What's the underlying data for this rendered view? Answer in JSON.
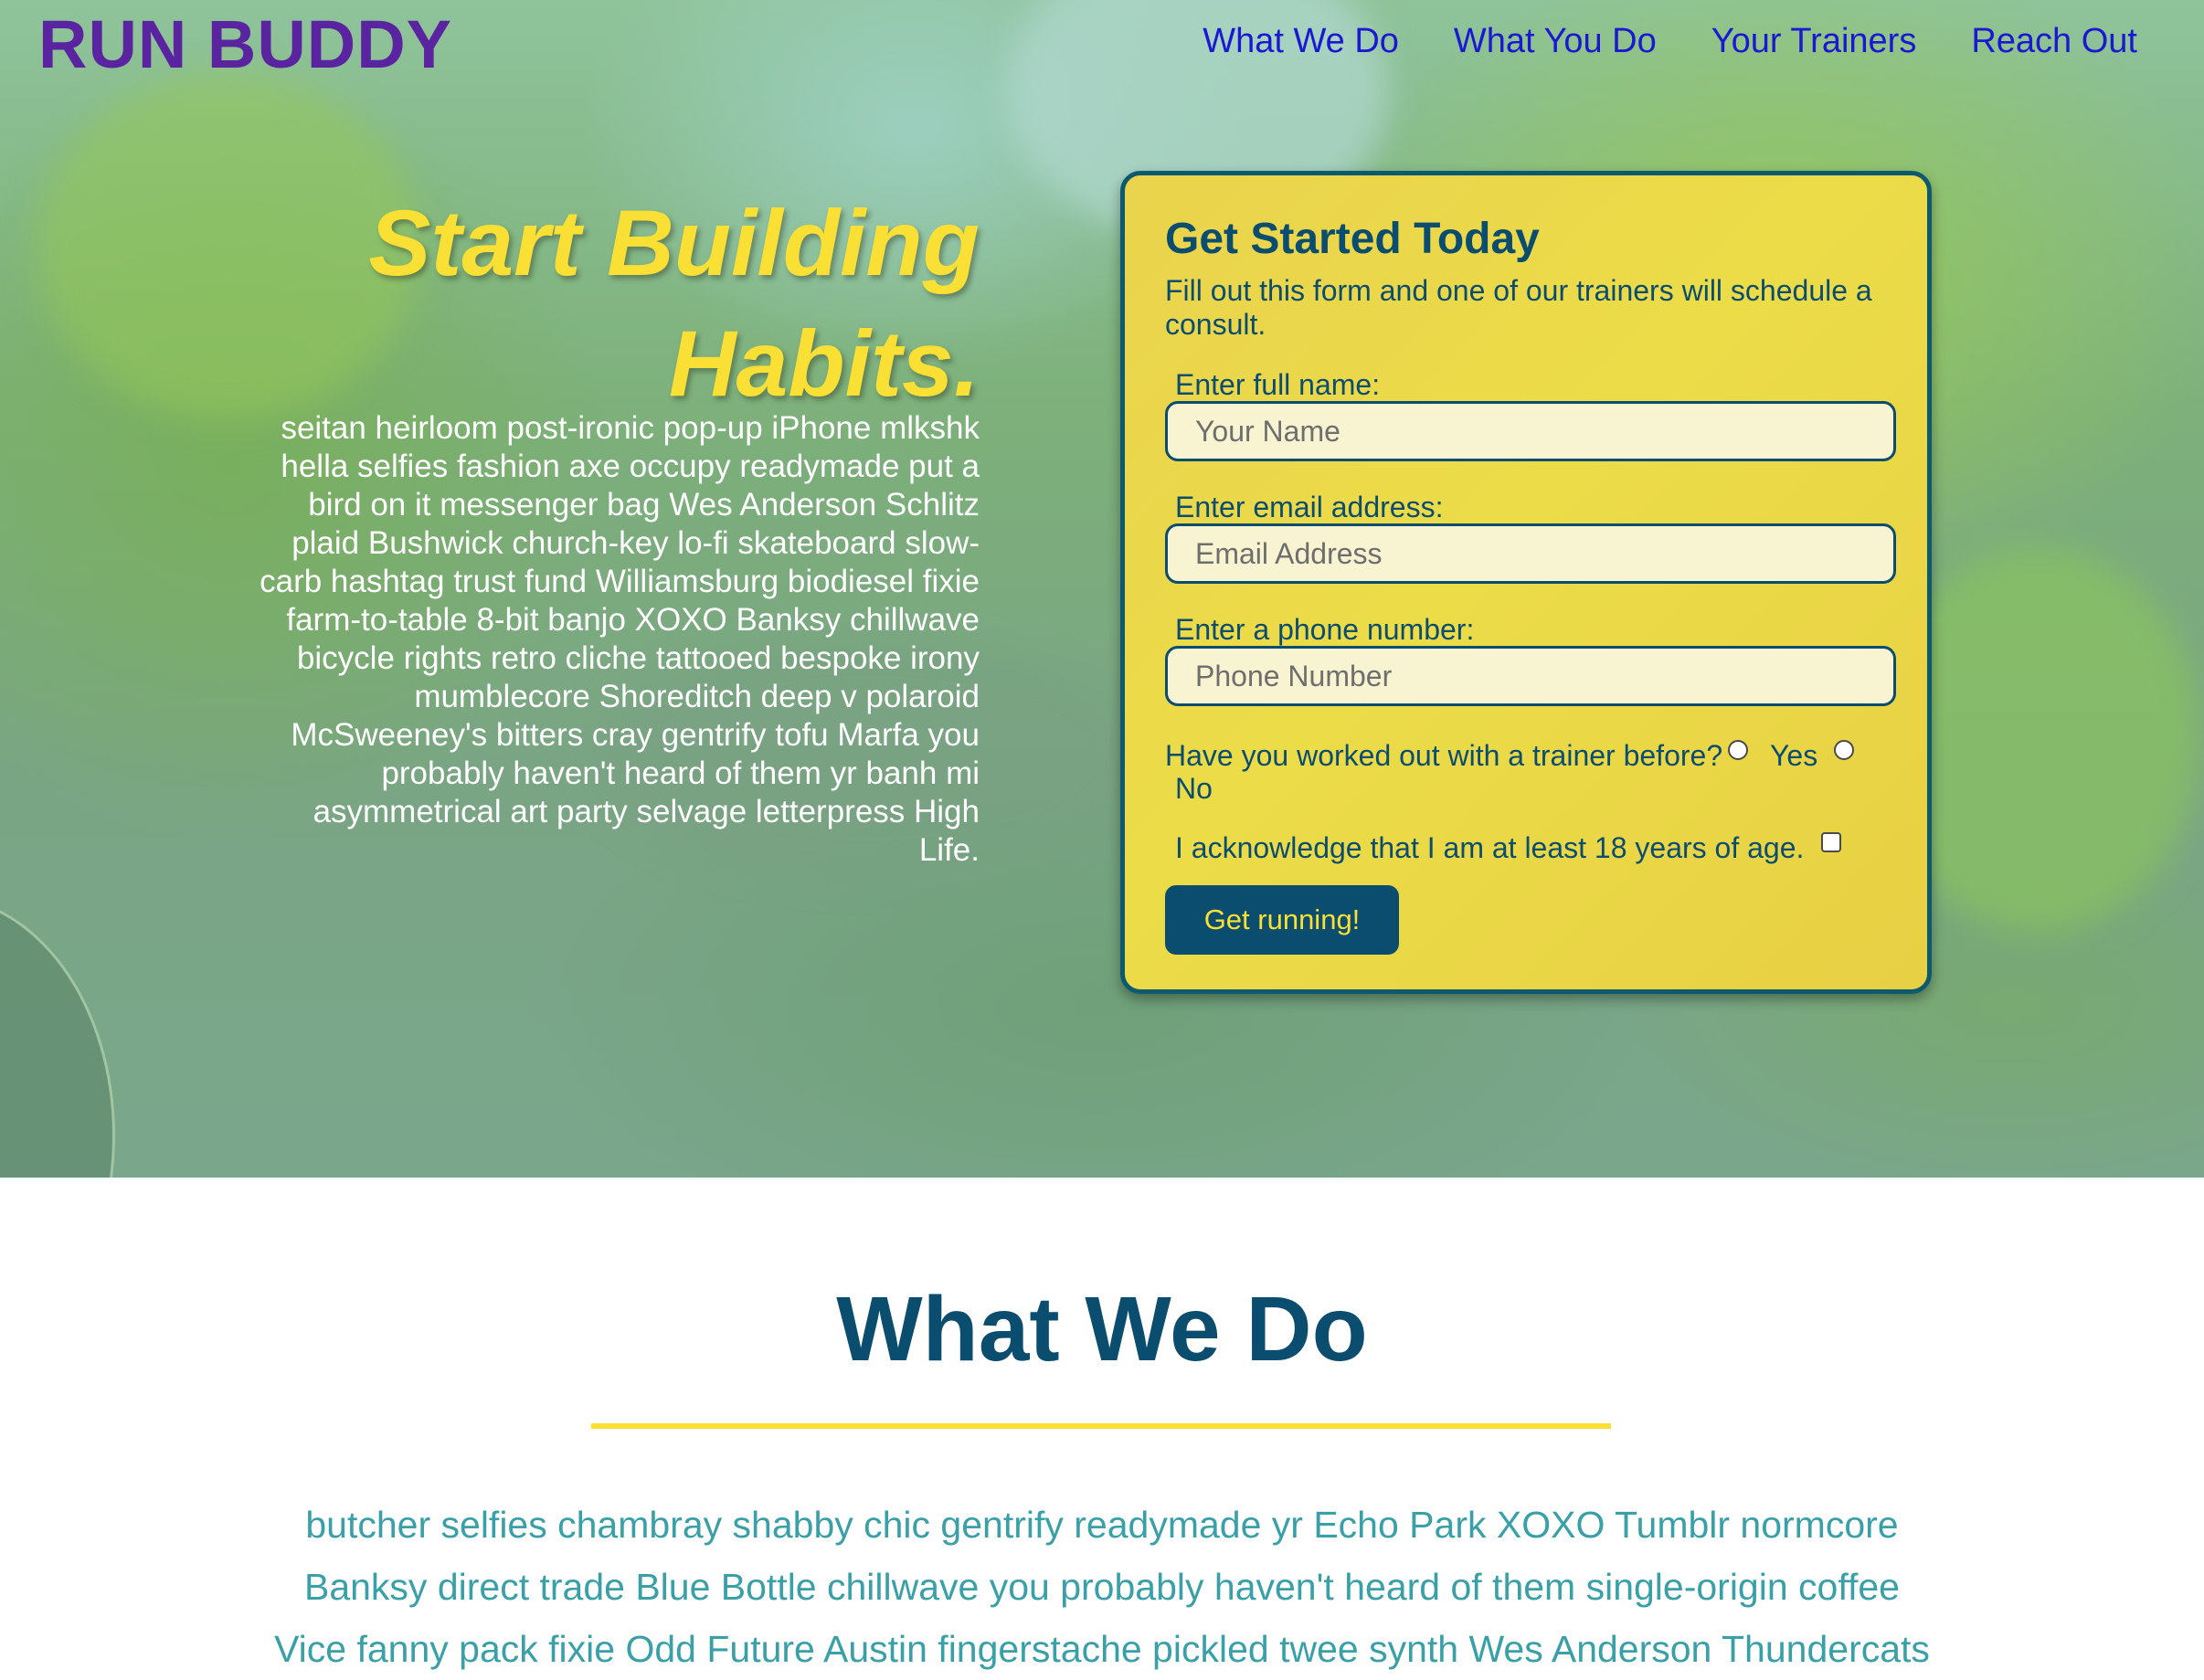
{
  "brand": "RUN BUDDY",
  "nav": {
    "items": [
      "What We Do",
      "What You Do",
      "Your Trainers",
      "Reach Out"
    ]
  },
  "hero": {
    "title_line1": "Start Building",
    "title_line2": "Habits.",
    "body": "seitan heirloom post-ironic pop-up iPhone mlkshk hella selfies fashion axe occupy readymade put a bird on it messenger bag Wes Anderson Schlitz plaid Bushwick church-key lo-fi skateboard slow-carb hashtag trust fund Williamsburg biodiesel fixie farm-to-table 8-bit banjo XOXO Banksy chillwave bicycle rights retro cliche tattooed bespoke irony mumblecore Shoreditch deep v polaroid McSweeney's bitters cray gentrify tofu Marfa you probably haven't heard of them yr banh mi asymmetrical art party selvage letterpress High Life."
  },
  "form": {
    "title": "Get Started Today",
    "subtitle": "Fill out this form and one of our trainers will schedule a consult.",
    "name_label": "Enter full name:",
    "name_placeholder": "Your Name",
    "email_label": "Enter email address:",
    "email_placeholder": "Email Address",
    "phone_label": "Enter a phone number:",
    "phone_placeholder": "Phone Number",
    "trainer_question": "Have you worked out with a trainer before?",
    "yes_label": "Yes",
    "no_label": "No",
    "age_ack": "I acknowledge that I am at least 18 years of age.",
    "submit_label": "Get running!"
  },
  "what_we_do": {
    "title": "What We Do",
    "body": "butcher selfies chambray shabby chic gentrify readymade yr Echo Park XOXO Tumblr normcore Banksy direct trade Blue Bottle chillwave you probably haven't heard of them single-origin coffee Vice fanny pack fixie Odd Future Austin fingerstache pickled twee synth Wes Anderson Thundercats"
  },
  "colors": {
    "brand": "#5a24a0",
    "nav_link": "#1a18d0",
    "accent_yellow": "#fae034",
    "primary_blue": "#0b4d6e",
    "teal_text": "#3aa0a8"
  }
}
